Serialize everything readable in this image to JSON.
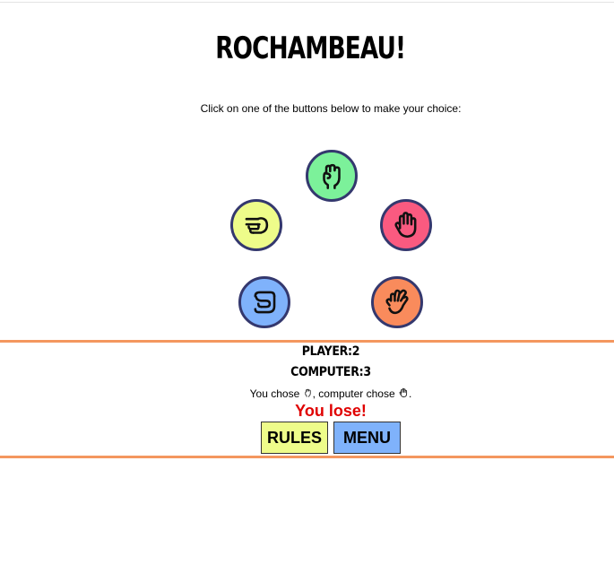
{
  "header": {
    "title": "ROCHAMBEAU!"
  },
  "instructions": "Click on one of the buttons below to make your choice:",
  "choices": [
    {
      "id": "rock",
      "icon": "fist-icon",
      "color": "#7cf19a"
    },
    {
      "id": "scissors",
      "icon": "pointing-hand-icon",
      "color": "#eefc8a"
    },
    {
      "id": "paper",
      "icon": "raised-hand-icon",
      "color": "#fa5a80"
    },
    {
      "id": "lizard",
      "icon": "lizard-hand-icon",
      "color": "#7fb2fb"
    },
    {
      "id": "spock",
      "icon": "vulcan-salute-icon",
      "color": "#f98b5c"
    }
  ],
  "scores": {
    "player": "PLAYER:2",
    "computer": "COMPUTER:3"
  },
  "result": {
    "prefix": "You chose ",
    "middle": ", computer chose ",
    "suffix": ".",
    "player_choice_icon": "fist-icon",
    "computer_choice_icon": "raised-hand-icon",
    "outcome": "You lose!",
    "outcome_color": "#e00000"
  },
  "buttons": {
    "rules": {
      "label": "RULES",
      "color": "#eefc8a"
    },
    "menu": {
      "label": "MENU",
      "color": "#7fb2fb"
    }
  },
  "colors": {
    "divider": "#f4975f",
    "circle_border": "#34386e"
  }
}
